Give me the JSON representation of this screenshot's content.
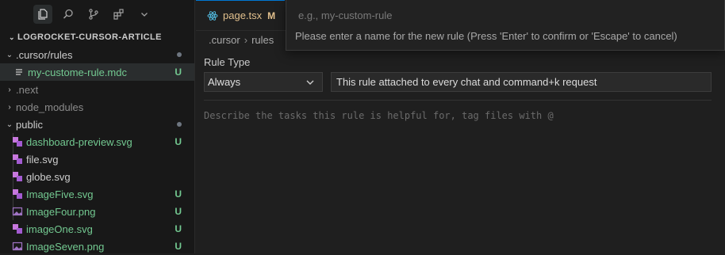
{
  "activity_bar": {
    "icons": [
      "files-icon",
      "search-icon",
      "source-control-icon",
      "extensions-icon",
      "chevron-down-icon"
    ]
  },
  "explorer": {
    "root_label": "LOGROCKET-CURSOR-ARTICLE",
    "items": [
      {
        "label": ".cursor/rules",
        "type": "folder",
        "expanded": true,
        "status_dot": true
      },
      {
        "label": "my-custome-rule.mdc",
        "type": "file",
        "icon": "lines-file-icon",
        "badge": "U",
        "selected": true
      },
      {
        "label": ".next",
        "type": "folder",
        "expanded": false
      },
      {
        "label": "node_modules",
        "type": "folder",
        "expanded": false
      },
      {
        "label": "public",
        "type": "folder",
        "expanded": true,
        "status_dot": true
      },
      {
        "label": "dashboard-preview.svg",
        "type": "file",
        "icon": "svg-file-icon",
        "badge": "U"
      },
      {
        "label": "file.svg",
        "type": "file",
        "icon": "svg-file-icon"
      },
      {
        "label": "globe.svg",
        "type": "file",
        "icon": "svg-file-icon"
      },
      {
        "label": "ImageFive.svg",
        "type": "file",
        "icon": "svg-file-icon",
        "badge": "U"
      },
      {
        "label": "ImageFour.png",
        "type": "file",
        "icon": "image-file-icon",
        "badge": "U"
      },
      {
        "label": "imageOne.svg",
        "type": "file",
        "icon": "svg-file-icon",
        "badge": "U"
      },
      {
        "label": "ImageSeven.png",
        "type": "file",
        "icon": "image-file-icon",
        "badge": "U"
      }
    ]
  },
  "editor": {
    "tab": {
      "label": "page.tsx",
      "status": "M"
    },
    "breadcrumb": [
      ".cursor",
      "rules"
    ],
    "rule_type_label": "Rule Type",
    "rule_type_value": "Always",
    "rule_description": "This rule attached to every chat and command+k request",
    "body_placeholder": "Describe the tasks this rule is helpful for, tag files with @"
  },
  "quick_input": {
    "placeholder": "e.g., my-custom-rule",
    "value": "",
    "message": "Please enter a name for the new rule (Press 'Enter' to confirm or 'Escape' to cancel)"
  },
  "colors": {
    "untracked": "#73c991",
    "modified": "#e2c08d",
    "accent": "#0078d4"
  }
}
